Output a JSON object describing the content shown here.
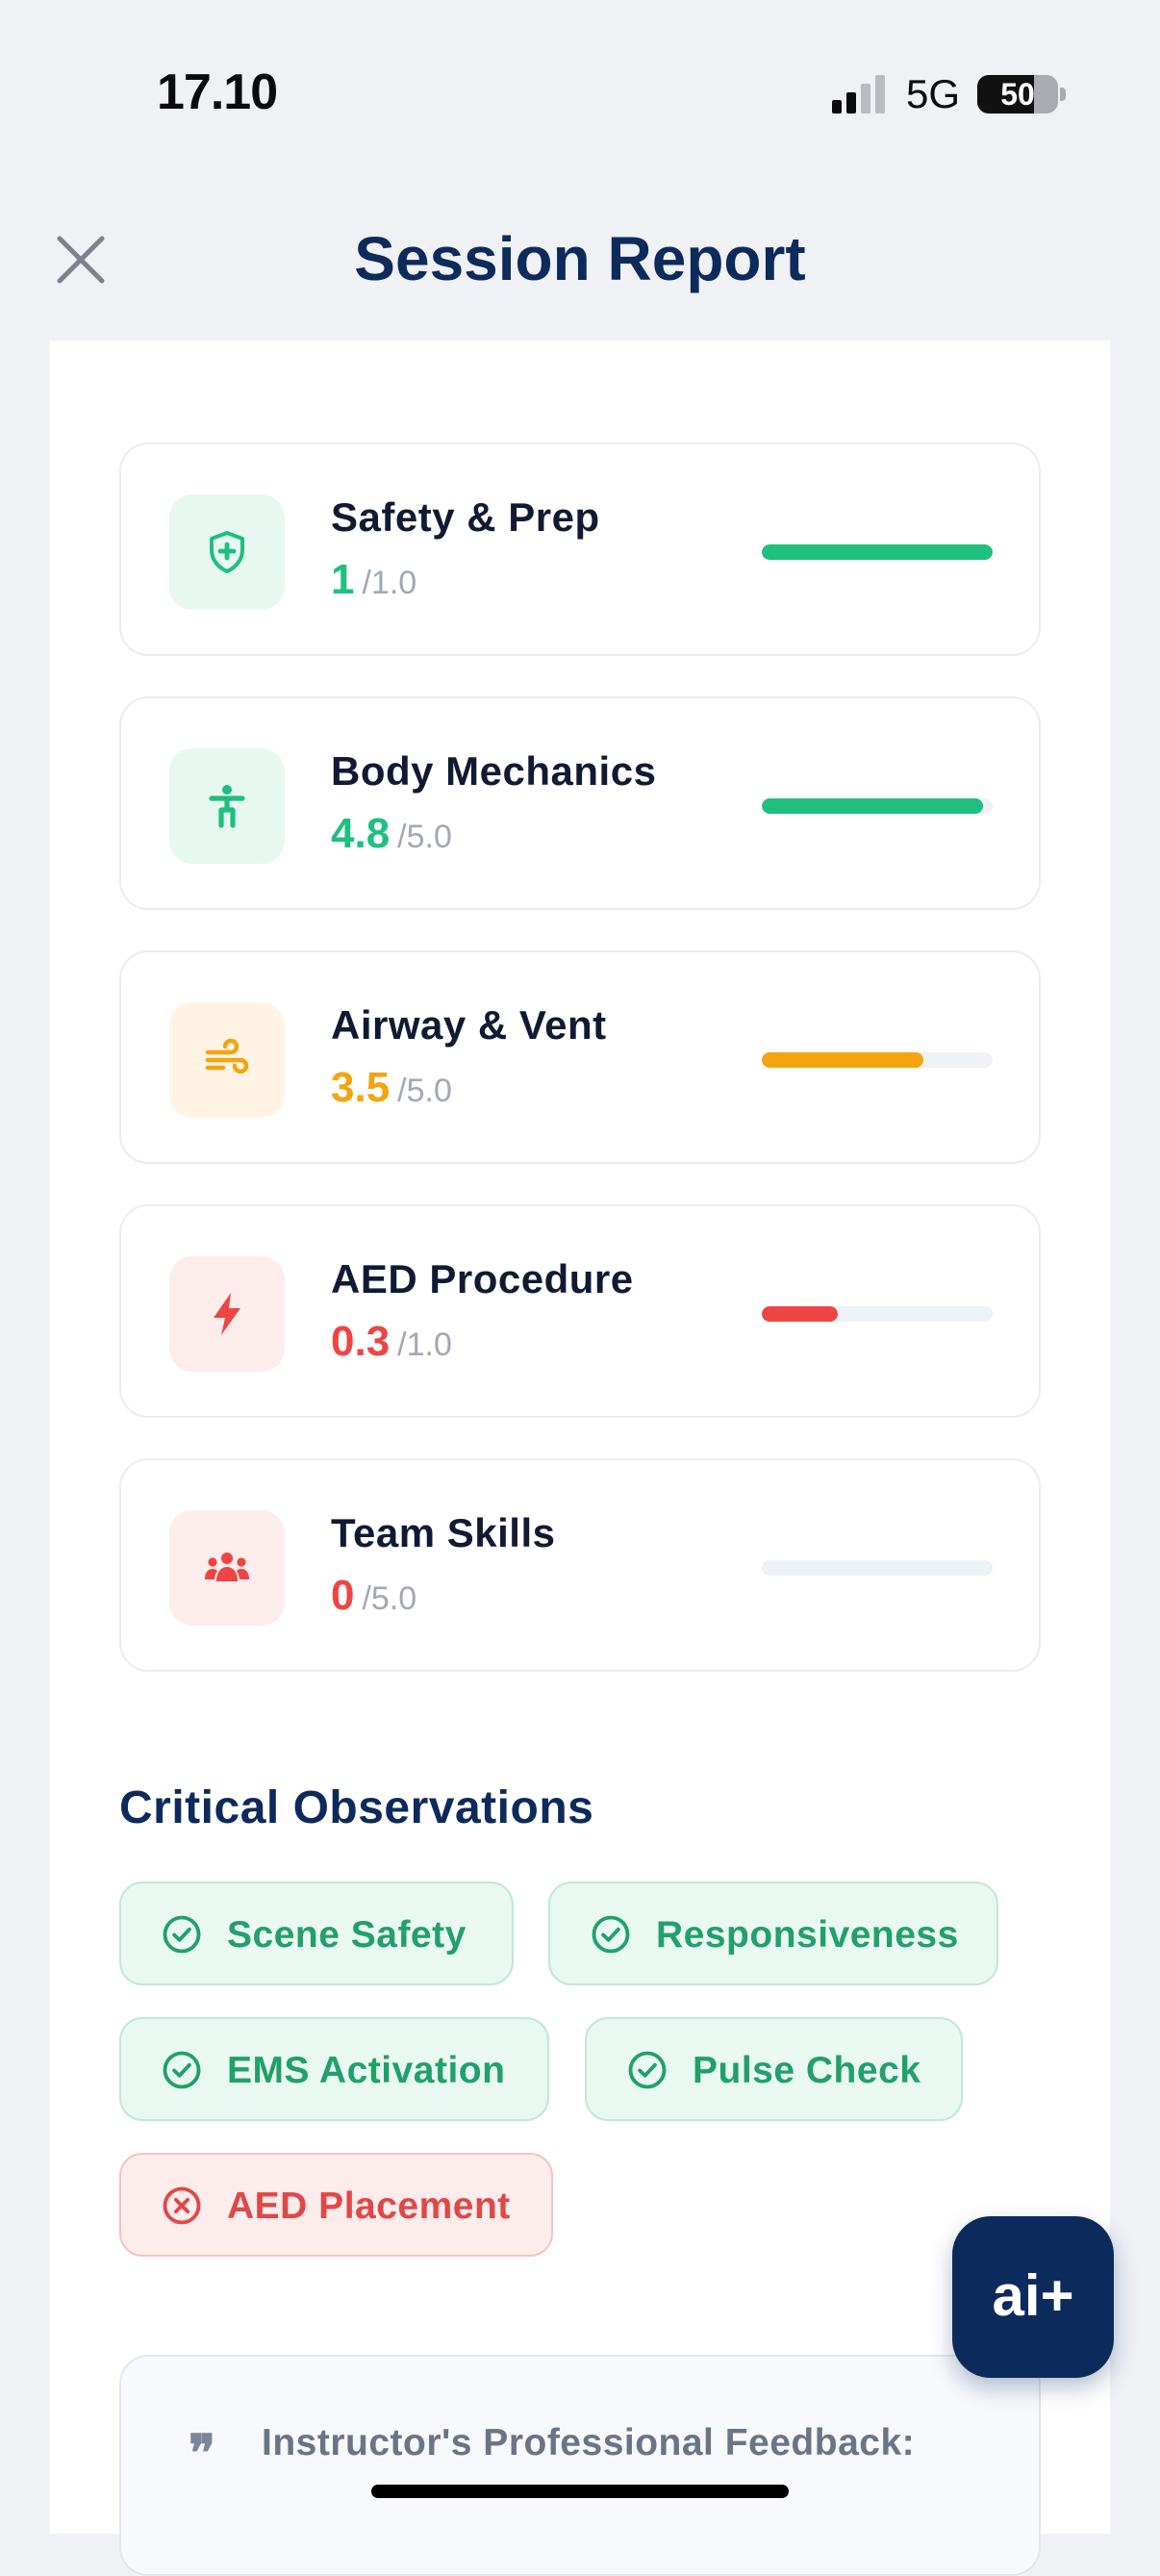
{
  "status_bar": {
    "time": "17.10",
    "network": "5G",
    "battery": "50"
  },
  "header": {
    "title": "Session Report",
    "close_icon": "close-icon"
  },
  "metrics": [
    {
      "label": "Safety & Prep",
      "score": "1",
      "max": "/1.0",
      "fraction": 1.0,
      "color": "#1fbf7f",
      "icon": "shield-plus-icon",
      "icon_bg": "#e6f8f0",
      "icon_color": "#1fbf7f"
    },
    {
      "label": "Body Mechanics",
      "score": "4.8",
      "max": "/5.0",
      "fraction": 0.96,
      "color": "#1fbf7f",
      "icon": "person-icon",
      "icon_bg": "#e6f8f0",
      "icon_color": "#1fbf7f"
    },
    {
      "label": "Airway & Vent",
      "score": "3.5",
      "max": "/5.0",
      "fraction": 0.7,
      "color": "#f5a30f",
      "icon": "wind-icon",
      "icon_bg": "#fff4e3",
      "icon_color": "#f5a30f"
    },
    {
      "label": "AED Procedure",
      "score": "0.3",
      "max": "/1.0",
      "fraction": 0.33,
      "color": "#ef4444",
      "icon": "lightning-icon",
      "icon_bg": "#fdecec",
      "icon_color": "#ef4444"
    },
    {
      "label": "Team Skills",
      "score": "0",
      "max": "/5.0",
      "fraction": 0.0,
      "color": "#ef4444",
      "icon": "team-icon",
      "icon_bg": "#fdecec",
      "icon_color": "#ef4444"
    }
  ],
  "observations": {
    "title": "Critical Observations",
    "items": [
      {
        "label": "Scene Safety",
        "status": "pass"
      },
      {
        "label": "Responsiveness",
        "status": "pass"
      },
      {
        "label": "EMS Activation",
        "status": "pass"
      },
      {
        "label": "Pulse Check",
        "status": "pass"
      },
      {
        "label": "AED Placement",
        "status": "fail"
      }
    ]
  },
  "feedback": {
    "title": "Instructor's Professional Feedback:",
    "quote_mark": "❞"
  },
  "ai_button": {
    "label": "ai+"
  }
}
